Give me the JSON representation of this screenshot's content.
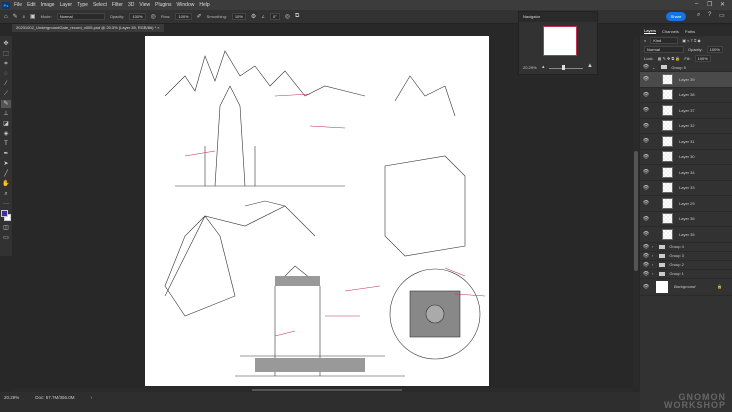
{
  "menubar": {
    "logo": "Ps",
    "items": [
      "File",
      "Edit",
      "Image",
      "Layer",
      "Type",
      "Select",
      "Filter",
      "3D",
      "View",
      "Plugins",
      "Window",
      "Help"
    ]
  },
  "options": {
    "mode_label": "Mode:",
    "mode": "Normal",
    "opacity_label": "Opacity:",
    "opacity": "100%",
    "flow_label": "Flow:",
    "flow": "100%",
    "smoothing_label": "Smoothing:",
    "smoothing": "10%",
    "angle": "0°",
    "brush_size": "8"
  },
  "share_label": "Share",
  "doc_tab": "20231002_UndergroundGate_record_v005.psd @ 20.3% (Layer 39, RGB/8#) *",
  "navigator": {
    "title": "Navigator",
    "zoom": "20.29%"
  },
  "status": {
    "zoom": "20.29%",
    "doc": "Doc: 57.7M/356.0M"
  },
  "layers_panel": {
    "tabs": [
      "Layers",
      "Channels",
      "Paths"
    ],
    "kind": "Kind",
    "blend": "Normal",
    "opacity_label": "Opacity:",
    "opacity": "100%",
    "lock_label": "Lock:",
    "fill_label": "Fill:",
    "fill": "100%",
    "group_open": "Group 5",
    "layers": [
      "Layer 39",
      "Layer 38",
      "Layer 37",
      "Layer 32",
      "Layer 31",
      "Layer 30",
      "Layer 34",
      "Layer 33",
      "Layer 29",
      "Layer 36",
      "Layer 35"
    ],
    "groups": [
      "Group 4",
      "Group 3",
      "Group 2",
      "Group 1"
    ],
    "background": "Background"
  },
  "watermark": "GNOMON WORKSHOP"
}
